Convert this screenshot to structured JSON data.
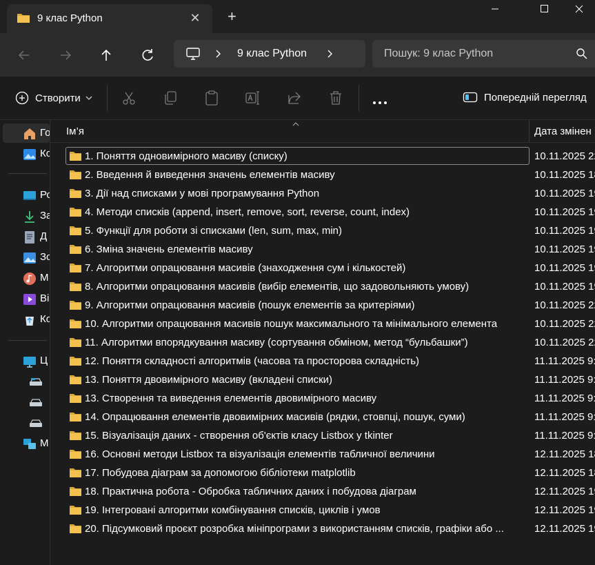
{
  "window": {
    "tab_title": "9 клас Python",
    "close_tab_glyph": "✕",
    "new_tab_glyph": "+"
  },
  "nav": {
    "address": "9 клас Python",
    "search_placeholder": "Пошук: 9 клас Python"
  },
  "toolbar": {
    "new_label": "Створити",
    "preview_label": "Попередній перегляд"
  },
  "sidebar": {
    "items": [
      {
        "label": "Го",
        "icon": "home-icon"
      },
      {
        "label": "Ко",
        "icon": "gallery-icon"
      },
      {
        "label": "Ро",
        "icon": "desktop-icon"
      },
      {
        "label": "За",
        "icon": "downloads-icon"
      },
      {
        "label": "Д",
        "icon": "documents-icon"
      },
      {
        "label": "Зо",
        "icon": "pictures-icon"
      },
      {
        "label": "М",
        "icon": "music-icon"
      },
      {
        "label": "Ві",
        "icon": "videos-icon"
      },
      {
        "label": "Ко",
        "icon": "recycle-bin-icon"
      },
      {
        "label": "Ц",
        "icon": "this-pc-icon"
      },
      {
        "label": "",
        "icon": "drive-icon"
      },
      {
        "label": "",
        "icon": "drive-icon"
      },
      {
        "label": "",
        "icon": "drive-icon"
      },
      {
        "label": "М",
        "icon": "network-icon"
      }
    ]
  },
  "list": {
    "col_name": "Ім’я",
    "col_date": "Дата змінен",
    "rows": [
      {
        "name": "1. Поняття одновимірного масиву (списку)",
        "date": "10.11.2025 22:"
      },
      {
        "name": "2. Введення й виведення значень елементів масиву",
        "date": "10.11.2025 18:"
      },
      {
        "name": "3. Дії над списками у мові програмування Python",
        "date": "10.11.2025 19:"
      },
      {
        "name": "4. Методи списків (append, insert, remove, sort, reverse, count, index)",
        "date": "10.11.2025 19:"
      },
      {
        "name": "5. Функції для роботи зі списками (len, sum, max, min)",
        "date": "10.11.2025 19:"
      },
      {
        "name": "6. Зміна значень елементів масиву",
        "date": "10.11.2025 19:"
      },
      {
        "name": "7. Алгоритми опрацювання масивів (знаходження сум і кількостей)",
        "date": "10.11.2025 19:"
      },
      {
        "name": "8. Алгоритми опрацювання масивів (вибір елементів, що задовольняють умову)",
        "date": "10.11.2025 19:"
      },
      {
        "name": "9. Алгоритми опрацювання масивів (пошук елементів за критеріями)",
        "date": "10.11.2025 22:"
      },
      {
        "name": "10. Алгоритми опрацювання масивів пошук максимального та мінімального елемента",
        "date": "10.11.2025 22:"
      },
      {
        "name": "11. Алгоритми впорядкування масиву (сортування обміном, метод “бульбашки”)",
        "date": "10.11.2025 22:"
      },
      {
        "name": "12. Поняття складності алгоритмів (часова та просторова складність)",
        "date": "11.11.2025 9:2"
      },
      {
        "name": "13. Поняття двовимірного масиву (вкладені списки)",
        "date": "11.11.2025 9:3"
      },
      {
        "name": "13. Створення та виведення елементів двовимірного масиву",
        "date": "11.11.2025 9:3"
      },
      {
        "name": "14. Опрацювання елементів двовимірних масивів (рядки, стовпці, пошук, суми)",
        "date": "11.11.2025 9:4"
      },
      {
        "name": "15. Візуалізація даних - створення об'єктів класу Listbox у tkinter",
        "date": "11.11.2025 9:5"
      },
      {
        "name": "16. Основні методи Listbox та візуалізація елементів табличної величини",
        "date": "12.11.2025 18:"
      },
      {
        "name": "17. Побудова діаграм за допомогою бібліотеки matplotlib",
        "date": "12.11.2025 18:"
      },
      {
        "name": "18. Практична робота - Обробка табличних даних і побудова діаграм",
        "date": "12.11.2025 19:"
      },
      {
        "name": "19. Інтегровані алгоритми комбінування списків, циклів і умов",
        "date": "12.11.2025 19:"
      },
      {
        "name": "20. Підсумковий проєкт розробка мініпрограми з використанням списків, графіки або ...",
        "date": "12.11.2025 19:"
      }
    ]
  },
  "colors": {
    "folder": "#f2c14e",
    "folder_dark": "#d9a83a",
    "background": "#1c1c1c",
    "bar": "#2b2b2b"
  }
}
